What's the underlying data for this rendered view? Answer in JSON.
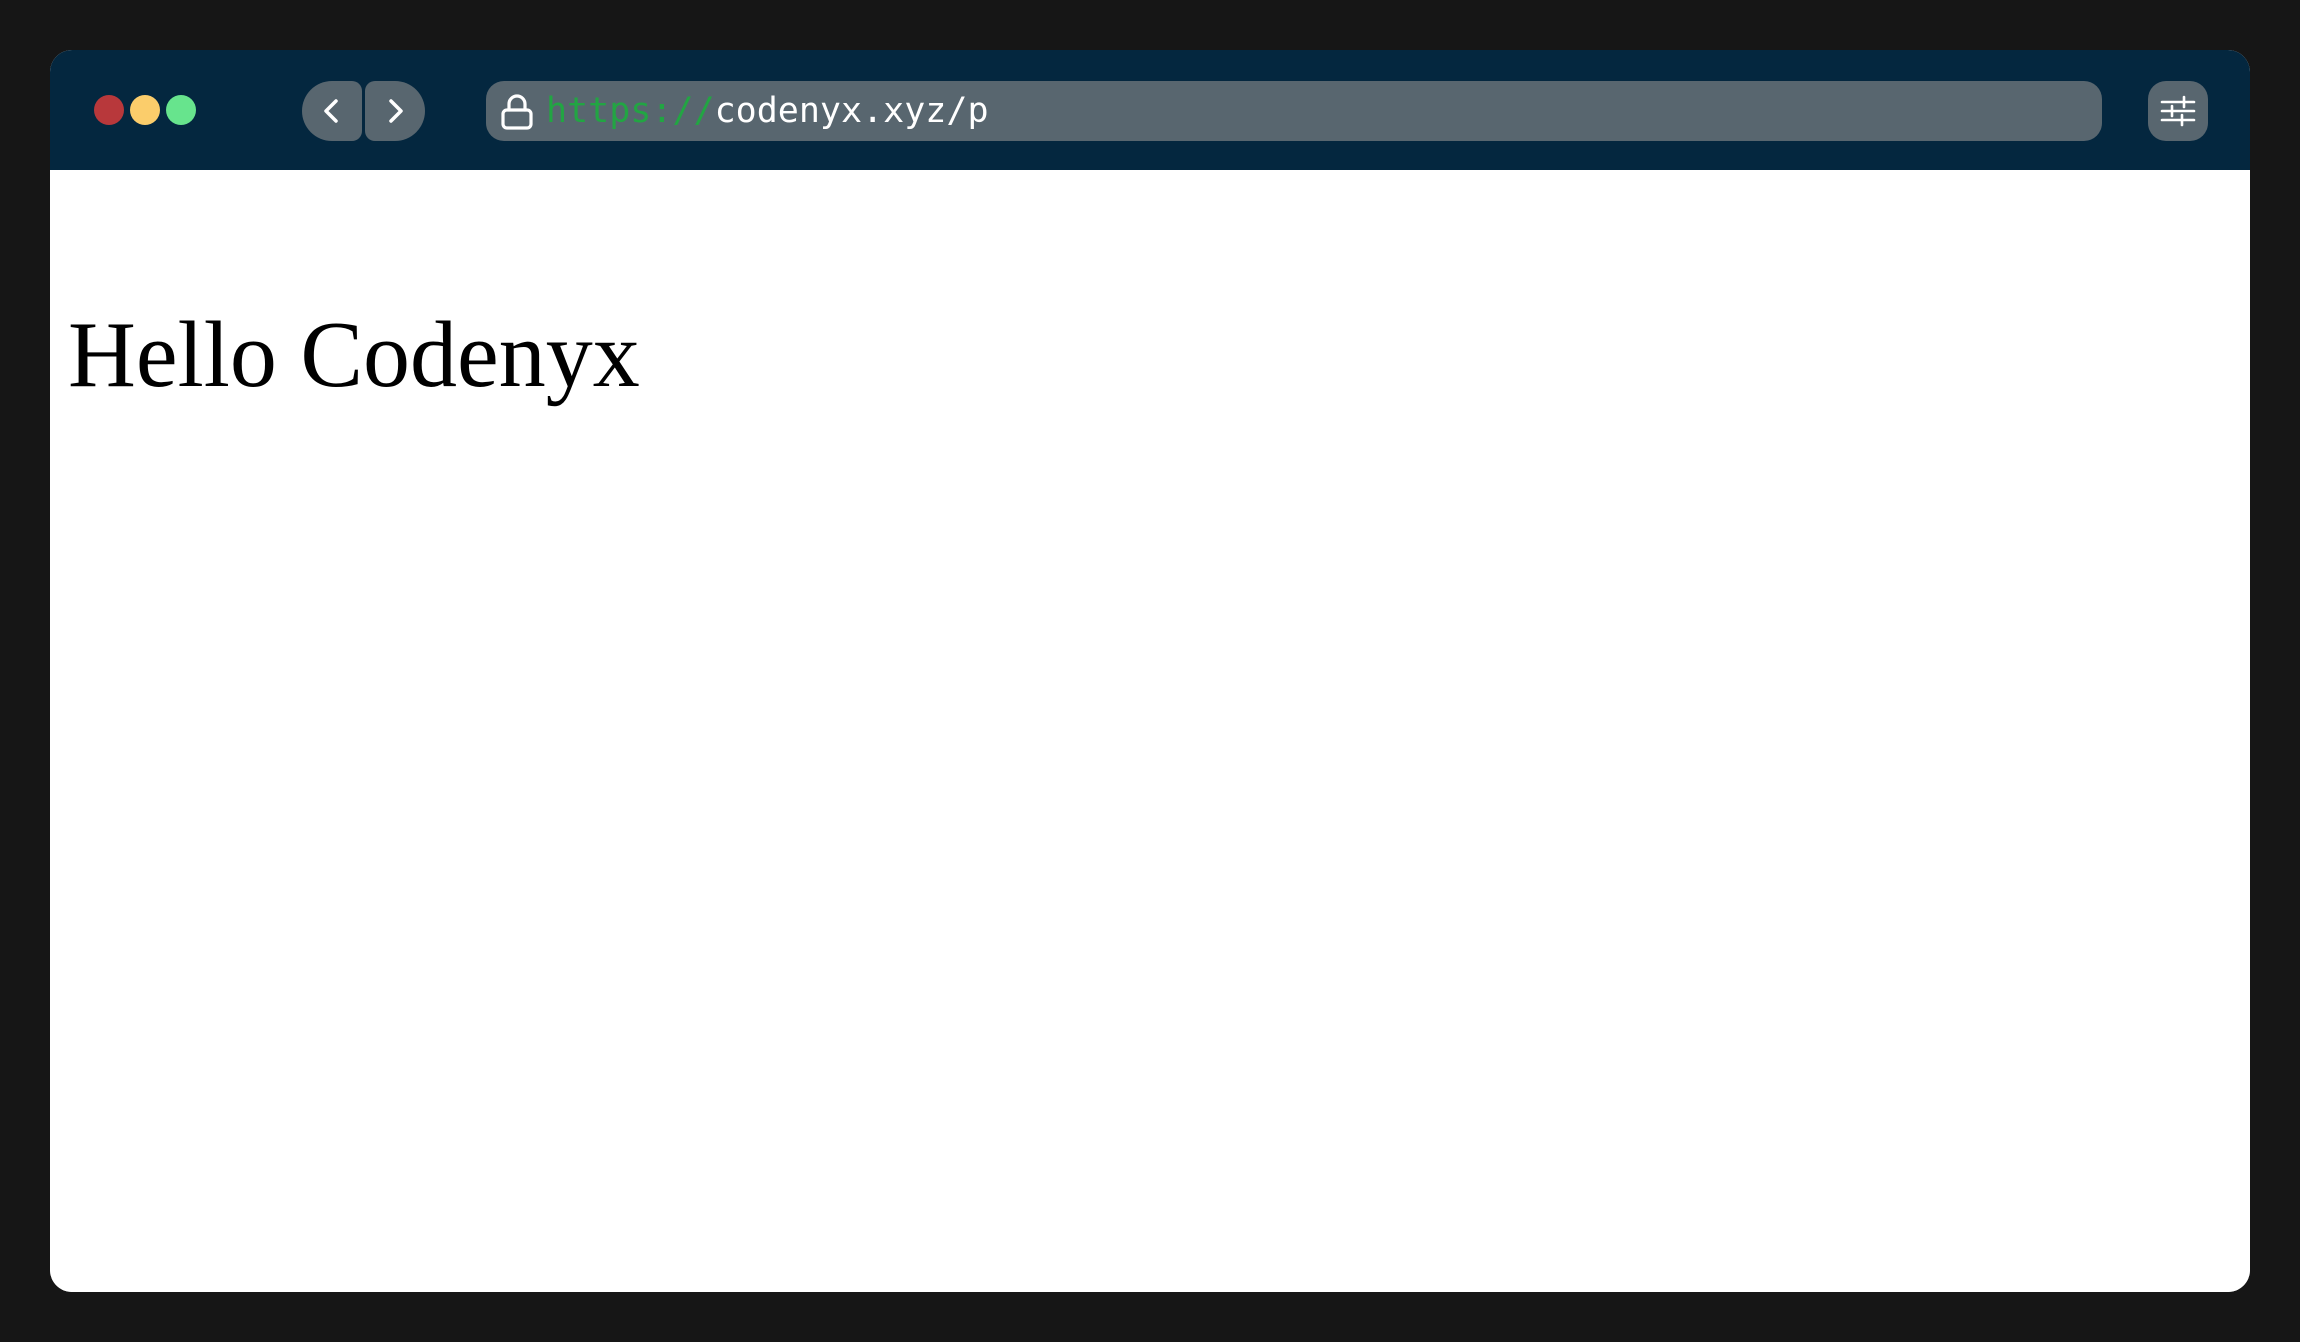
{
  "browser": {
    "window_controls": [
      "close",
      "minimize",
      "maximize"
    ],
    "nav": {
      "back_icon": "chevron-left-icon",
      "forward_icon": "chevron-right-icon"
    },
    "address_bar": {
      "lock_icon": "lock-icon",
      "url_scheme": "https://",
      "url_rest": "codenyx.xyz/p"
    },
    "settings_icon": "sliders-icon"
  },
  "page": {
    "heading": "Hello Codenyx"
  },
  "colors": {
    "backdrop": "#161616",
    "titlebar": "#04273f",
    "control_bg": "#58666f",
    "close": "#b8383b",
    "minimize": "#fbcd6b",
    "maximize": "#67e48d",
    "url_scheme": "#22a543",
    "url_text": "#ffffff"
  }
}
